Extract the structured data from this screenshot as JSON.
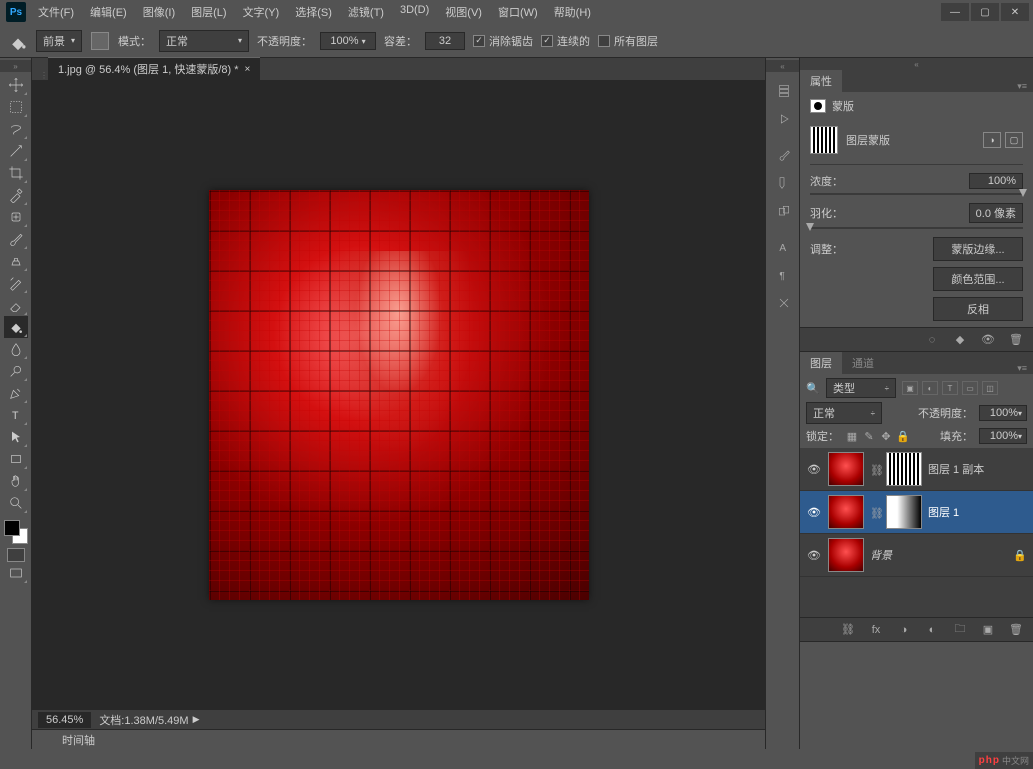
{
  "menubar": {
    "items": [
      {
        "label": "文件(F)"
      },
      {
        "label": "编辑(E)"
      },
      {
        "label": "图像(I)"
      },
      {
        "label": "图层(L)"
      },
      {
        "label": "文字(Y)"
      },
      {
        "label": "选择(S)"
      },
      {
        "label": "滤镜(T)"
      },
      {
        "label": "3D(D)"
      },
      {
        "label": "视图(V)"
      },
      {
        "label": "窗口(W)"
      },
      {
        "label": "帮助(H)"
      }
    ]
  },
  "optionsbar": {
    "fill_label": "前景",
    "mode_label": "模式：",
    "mode_value": "正常",
    "opacity_label": "不透明度：",
    "opacity_value": "100%",
    "tolerance_label": "容差：",
    "tolerance_value": "32",
    "antialias_label": "消除锯齿",
    "contiguous_label": "连续的",
    "all_layers_label": "所有图层"
  },
  "document": {
    "tab_title": "1.jpg @ 56.4% (图层 1, 快速蒙版/8) *",
    "zoom": "56.45%",
    "doc_info": "文档:1.38M/5.49M"
  },
  "timeline": {
    "label": "时间轴"
  },
  "panels": {
    "properties": {
      "tab": "属性",
      "type": "蒙版",
      "mask_type": "图层蒙版",
      "density_label": "浓度：",
      "density_value": "100%",
      "feather_label": "羽化：",
      "feather_value": "0.0 像素",
      "adjust_label": "调整：",
      "btn_mask_edge": "蒙版边缘...",
      "btn_color_range": "颜色范围...",
      "btn_invert": "反相"
    },
    "layers": {
      "tab_layers": "图层",
      "tab_channels": "通道",
      "filter_type": "类型",
      "blend_mode": "正常",
      "opacity_label": "不透明度：",
      "opacity_value": "100%",
      "lock_label": "锁定：",
      "fill_label": "填充：",
      "fill_value": "100%",
      "items": [
        {
          "name": "图层 1 副本",
          "mask": "stripe"
        },
        {
          "name": "图层 1",
          "mask": "gradient",
          "active": true
        },
        {
          "name": "背景",
          "locked": true,
          "italic": true
        }
      ]
    }
  },
  "brand": {
    "main": "php",
    "sub": "中文网"
  }
}
